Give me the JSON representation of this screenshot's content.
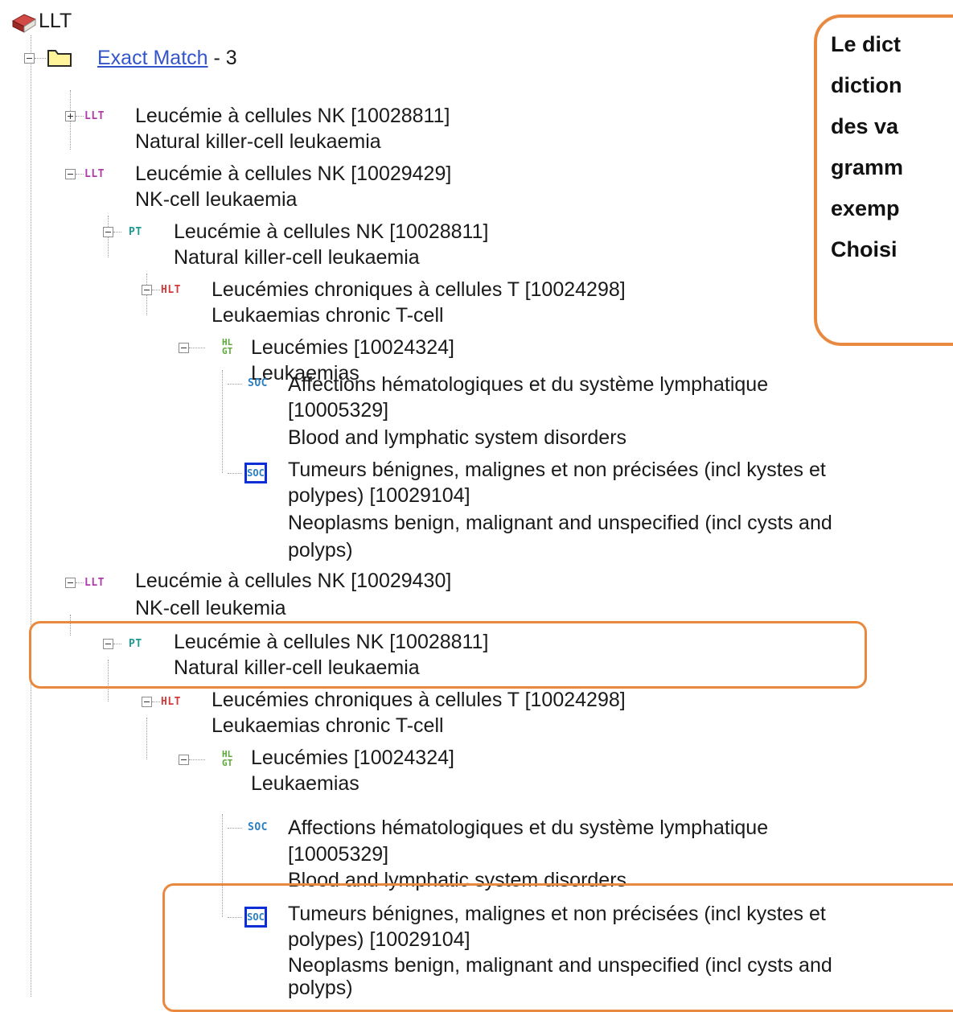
{
  "root": {
    "label": "LLT"
  },
  "group": {
    "label": "Exact Match",
    "count": " - 3"
  },
  "nodes": {
    "n1": {
      "badge": "LLT",
      "fr": "Leucémie à cellules NK [10028811]",
      "en": "Natural killer-cell leukaemia"
    },
    "n2": {
      "badge": "LLT",
      "fr": "Leucémie à cellules NK [10029429]",
      "en": "NK-cell leukaemia"
    },
    "n2_pt": {
      "badge": "PT",
      "fr": "Leucémie à cellules NK [10028811]",
      "en": "Natural killer-cell leukaemia"
    },
    "n2_hlt": {
      "badge": "HLT",
      "fr": "Leucémies chroniques à cellules T [10024298]",
      "en": "Leukaemias chronic T-cell"
    },
    "n2_hlgt": {
      "badge1": "HL",
      "badge2": "GT",
      "fr": "Leucémies [10024324]",
      "en": "Leukaemias"
    },
    "n2_soc1": {
      "badge": "SOC",
      "fr1": "Affections hématologiques et du système lymphatique",
      "fr2": "[10005329]",
      "en": "Blood and lymphatic system disorders"
    },
    "n2_soc2": {
      "badge": "SOC",
      "fr1": "Tumeurs bénignes, malignes et non précisées (incl kystes et",
      "fr2": "polypes) [10029104]",
      "en1": "Neoplasms benign, malignant and unspecified (incl cysts and",
      "en2": "polyps)"
    },
    "n3": {
      "badge": "LLT",
      "fr": "Leucémie à cellules NK [10029430]",
      "en": "NK-cell leukemia"
    },
    "n3_pt": {
      "badge": "PT",
      "fr": "Leucémie à cellules NK [10028811]",
      "en": "Natural killer-cell leukaemia"
    },
    "n3_hlt": {
      "badge": "HLT",
      "fr": "Leucémies chroniques à cellules T [10024298]",
      "en": "Leukaemias chronic T-cell"
    },
    "n3_hlgt": {
      "badge1": "HL",
      "badge2": "GT",
      "fr": "Leucémies [10024324]",
      "en": "Leukaemias"
    },
    "n3_soc1": {
      "badge": "SOC",
      "fr1": "Affections hématologiques et du système lymphatique",
      "fr2": "[10005329]",
      "en": "Blood and lymphatic system disorders"
    },
    "n3_soc2": {
      "badge": "SOC",
      "fr1": "Tumeurs bénignes, malignes et non précisées (incl kystes et",
      "fr2": "polypes) [10029104]",
      "en1": "Neoplasms benign, malignant and unspecified (incl cysts and",
      "en2": "polyps)"
    }
  },
  "callout": {
    "lines": [
      "Le dict",
      "diction",
      "des va",
      "gramm",
      "exemp",
      "Choisi"
    ]
  },
  "colors": {
    "highlight": "#e8893f",
    "link": "#3355cc",
    "llt_badge": "#b03aa8",
    "pt_badge": "#1c9a94",
    "hlt_badge": "#d33a3a",
    "soc_badge": "#2a7fc4",
    "hlgt_badge": "#5aa838",
    "primary_soc_border": "#0a2fd6"
  },
  "icons": {
    "root": "book-icon",
    "group": "folder-icon"
  }
}
